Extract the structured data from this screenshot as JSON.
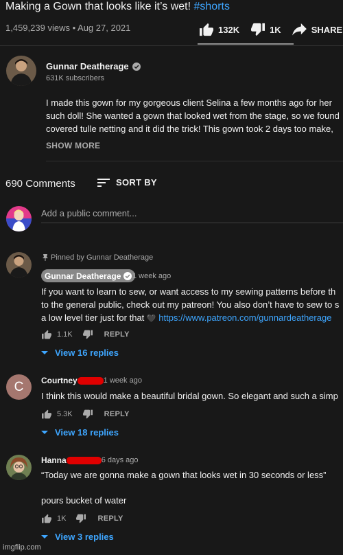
{
  "video": {
    "title": "Making a Gown that looks like it’s wet!",
    "hashtag": "#shorts",
    "views": "1,459,239 views",
    "date": "Aug 27, 2021",
    "likes": "132K",
    "dislikes": "1K",
    "share_label": "SHARE"
  },
  "channel": {
    "name": "Gunnar Deatherage",
    "subscribers": "631K subscribers",
    "description_lines": [
      "I made this gown for my gorgeous client Selina a few months ago for her",
      "such doll! She wanted a gown that looked wet from the stage, so we found",
      "covered tulle netting and it did the trick! This gown took 2 days too make,"
    ],
    "show_more": "SHOW MORE"
  },
  "comments_header": {
    "count": "690 Comments",
    "sort_label": "SORT BY",
    "add_placeholder": "Add a public comment..."
  },
  "comments": [
    {
      "pinned_label": "Pinned by Gunnar Deatherage",
      "author": "Gunnar Deatherage",
      "time": "1 week ago",
      "lines": [
        "If you want to learn to sew, or want access to my sewing patterns before th",
        "to the general public, check out my patreon! You also don’t have to sew to s"
      ],
      "line3_text": "a low level tier just for that ",
      "heart": "🖤",
      "link": "https://www.patreon.com/gunnardeatherage",
      "likes": "1.1K",
      "reply_label": "REPLY",
      "view_replies": "View 16 replies"
    },
    {
      "author": "Courtney",
      "avatar_letter": "C",
      "time": "1 week ago",
      "text": "I think this would make a beautiful bridal gown. So elegant and such a simp",
      "likes": "5.3K",
      "reply_label": "REPLY",
      "view_replies": "View 18 replies"
    },
    {
      "author": "Hanna",
      "time": "6 days ago",
      "text": "“Today we are gonna make a gown that looks wet in 30 seconds or less”",
      "text2": "pours bucket of water",
      "likes": "1K",
      "reply_label": "REPLY",
      "view_replies": "View 3 replies"
    }
  ],
  "watermark": "imgflip.com",
  "colors": {
    "background": "#181818",
    "link": "#3ea6ff",
    "secondary_text": "#aaaaaa",
    "redaction": "#e00000",
    "author_badge": "#888888"
  }
}
